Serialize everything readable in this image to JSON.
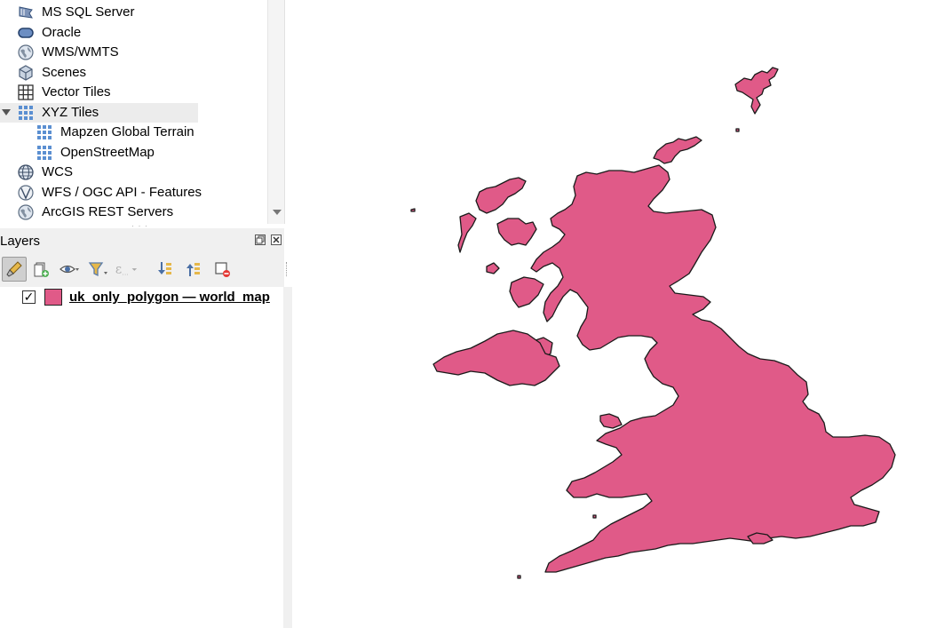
{
  "browser": {
    "items": [
      {
        "label": "MS SQL Server",
        "icon": "mssql-icon"
      },
      {
        "label": "Oracle",
        "icon": "oracle-icon"
      },
      {
        "label": "WMS/WMTS",
        "icon": "wms-globe-icon"
      },
      {
        "label": "Scenes",
        "icon": "scenes-cube-icon"
      },
      {
        "label": "Vector Tiles",
        "icon": "vector-tiles-grid-icon"
      },
      {
        "label": "XYZ Tiles",
        "icon": "xyz-tiles-grid-icon",
        "expanded": true,
        "selected": true
      },
      {
        "label": "Mapzen Global Terrain",
        "icon": "xyz-tiles-grid-icon",
        "child": true
      },
      {
        "label": "OpenStreetMap",
        "icon": "xyz-tiles-grid-icon",
        "child": true
      },
      {
        "label": "WCS",
        "icon": "wcs-globe-icon"
      },
      {
        "label": "WFS / OGC API - Features",
        "icon": "wfs-globe-icon"
      },
      {
        "label": "ArcGIS REST Servers",
        "icon": "arcgis-globe-icon"
      }
    ]
  },
  "layers_panel": {
    "title": "Layers",
    "toolbar": [
      "style-manager-icon",
      "add-group-icon",
      "manage-visibility-eye-icon",
      "filter-legend-icon",
      "filter-expression-icon",
      "expand-all-icon",
      "collapse-all-icon",
      "remove-layer-icon"
    ],
    "layers": [
      {
        "name": "uk_only_polygon — world_map",
        "checked": true,
        "color": "#e05a88"
      }
    ]
  },
  "map": {
    "fill_color": "#e05a88",
    "stroke_color": "#1a1a1a"
  }
}
